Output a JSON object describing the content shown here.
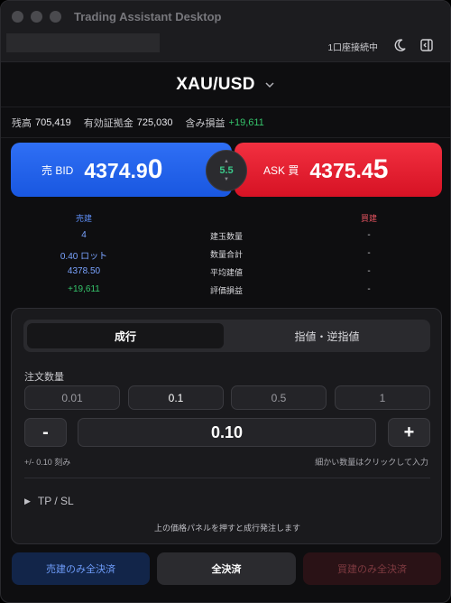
{
  "window": {
    "title": "Trading Assistant Desktop"
  },
  "toolbar": {
    "connection": "1口座接続中",
    "theme_icon": "moon-icon",
    "panel_icon": "sidebar-panel-icon"
  },
  "symbol": {
    "name": "XAU/USD"
  },
  "account": {
    "balance_label": "残高",
    "balance": "705,419",
    "margin_label": "有効証拠金",
    "margin": "725,030",
    "pl_label": "含み損益",
    "pl": "+19,611"
  },
  "quote": {
    "bid_label": "売 BID",
    "bid_main": "4374.9",
    "bid_big": "0",
    "ask_label": "ASK 買",
    "ask_main": "4375.4",
    "ask_big": "5",
    "spread": "5.5",
    "colors": {
      "bid": "#2f6ff5",
      "ask": "#f23040",
      "spread": "#3bc98a",
      "profit": "#35c46b"
    }
  },
  "positions": {
    "sell_header": "売建",
    "buy_header": "買建",
    "rows": [
      {
        "label": "建玉数量",
        "sell": "4",
        "buy": "-"
      },
      {
        "label": "数量合計",
        "sell": "0.40 ロット",
        "buy": "-"
      },
      {
        "label": "平均建値",
        "sell": "4378.50",
        "buy": "-"
      },
      {
        "label": "評価損益",
        "sell": "+19,611",
        "buy": "-"
      }
    ]
  },
  "order": {
    "tabs": [
      "成行",
      "指値・逆指値"
    ],
    "qty_label": "注文数量",
    "presets": [
      "0.01",
      "0.1",
      "0.5",
      "1"
    ],
    "minus": "-",
    "plus": "+",
    "qty_value": "0.10",
    "step_hint": "+/- 0.10 刻み",
    "fine_hint": "細かい数量はクリックして入力",
    "tpsl_label": "TP / SL",
    "footnote": "上の価格パネルを押すと成行発注します"
  },
  "close": {
    "sell_only": "売建のみ全決済",
    "all": "全決済",
    "buy_only": "買建のみ全決済"
  }
}
